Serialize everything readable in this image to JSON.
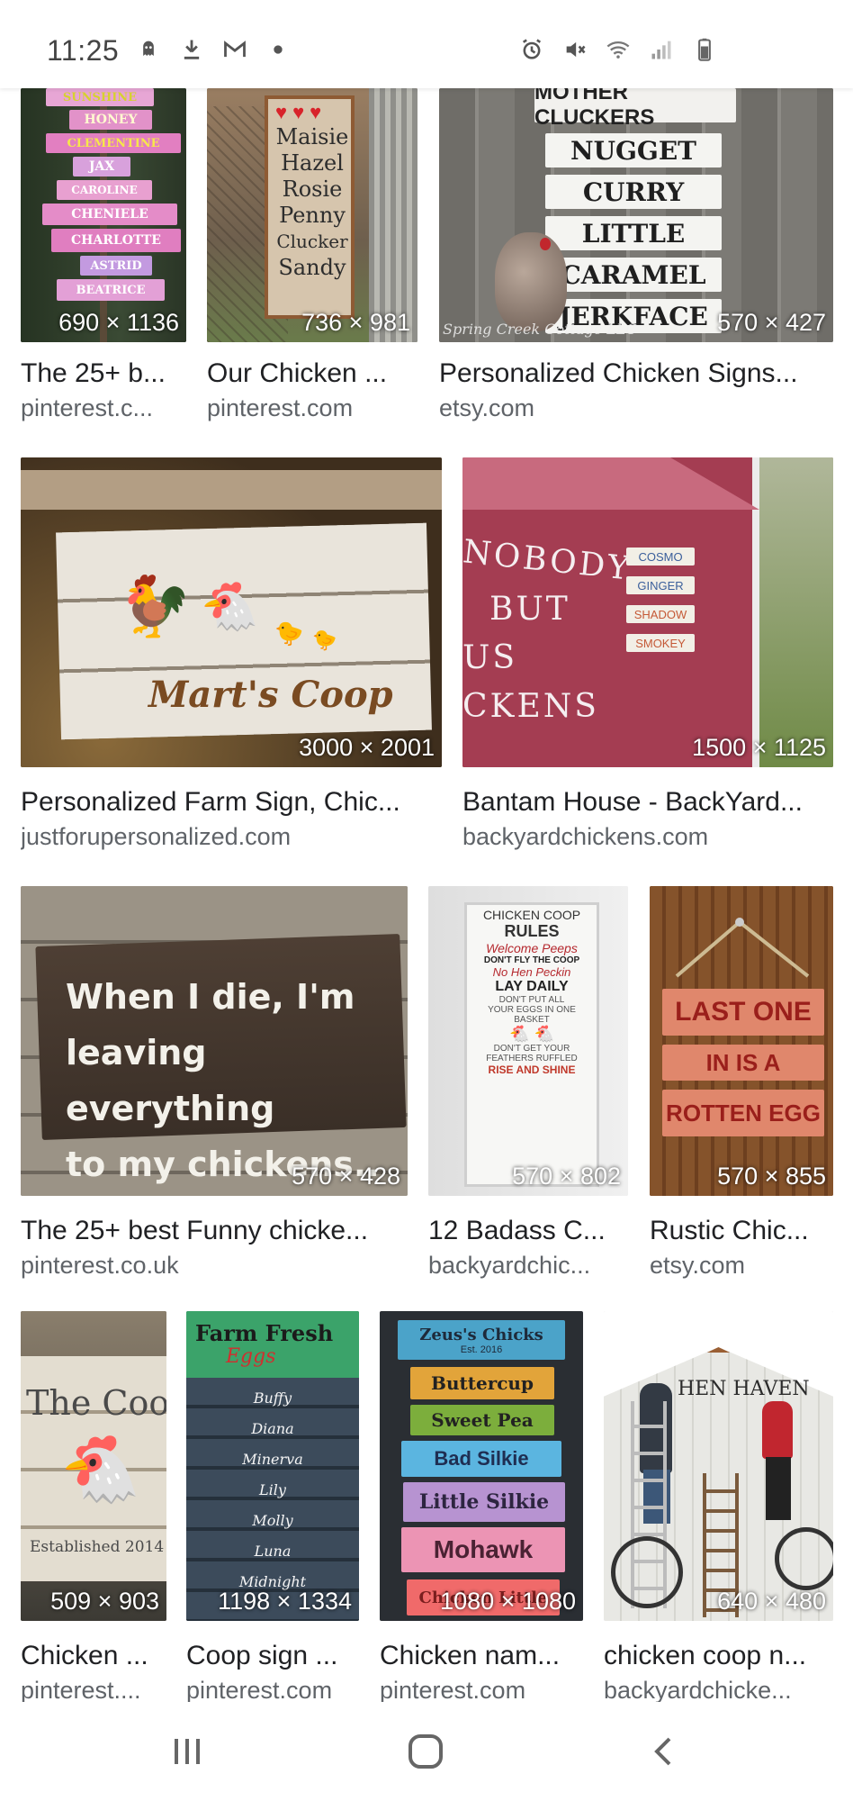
{
  "status_bar": {
    "time": "11:25",
    "left_icons": [
      "ghost-icon",
      "download-icon",
      "gmail-icon",
      "dot-icon"
    ],
    "right_icons": [
      "alarm-icon",
      "mute-icon",
      "wifi-icon",
      "signal-icon",
      "battery-icon"
    ]
  },
  "results": [
    {
      "title": "The 25+ b...",
      "domain": "pinterest.c...",
      "dims": "690 × 1136"
    },
    {
      "title": "Our Chicken ...",
      "domain": "pinterest.com",
      "dims": "736 × 981"
    },
    {
      "title": "Personalized Chicken Signs...",
      "domain": "etsy.com",
      "dims": "570 × 427"
    },
    {
      "title": "Personalized Farm Sign, Chic...",
      "domain": "justforupersonalized.com",
      "dims": "3000 × 2001"
    },
    {
      "title": "Bantam House - BackYard...",
      "domain": "backyardchickens.com",
      "dims": "1500 × 1125"
    },
    {
      "title": "The 25+ best Funny chicke...",
      "domain": "pinterest.co.uk",
      "dims": "570 × 428"
    },
    {
      "title": "12 Badass C...",
      "domain": "backyardchic...",
      "dims": "570 × 802"
    },
    {
      "title": "Rustic Chic...",
      "domain": "etsy.com",
      "dims": "570 × 855"
    },
    {
      "title": "Chicken ...",
      "domain": "pinterest....",
      "dims": "509 × 903"
    },
    {
      "title": "Coop sign ...",
      "domain": "pinterest.com",
      "dims": "1198 × 1334"
    },
    {
      "title": "Chicken nam...",
      "domain": "pinterest.com",
      "dims": "1080 × 1080"
    },
    {
      "title": "chicken coop n...",
      "domain": "backyardchicke...",
      "dims": "640 × 480"
    }
  ],
  "image_text": {
    "r1c1": [
      "SUNSHINE",
      "HONEY",
      "CLEMENTINE",
      "JAX",
      "CAROLINE",
      "CHENIELE",
      "CHARLOTTE",
      "ASTRID",
      "BEATRICE"
    ],
    "r1c2": [
      "Maisie",
      "Hazel",
      "Rosie",
      "Penny",
      "Clucker",
      "Sandy"
    ],
    "r1c3": [
      "MOTHER CLUCKERS",
      "NUGGET",
      "CURRY",
      "LITTLE",
      "CARAMEL",
      "JERKFACE",
      "Spring Creek Cottage LLC"
    ],
    "r2c1": "Mart's Coop",
    "r2c2_wall": [
      "NOBODY",
      "BUT",
      "US",
      "CKENS"
    ],
    "r2c2_tags": [
      "COSMO",
      "GINGER",
      "SHADOW",
      "SMOKEY"
    ],
    "r3c1": [
      "When I die, I'm",
      "leaving everything",
      "to my chickens.."
    ],
    "r3c2": [
      "CHICKEN COOP",
      "RULES",
      "Welcome Peeps",
      "DON'T FLY THE COOP",
      "No Hen Peckin",
      "LAY DAILY",
      "DON'T PUT ALL",
      "YOUR EGGS IN ONE",
      "BASKET",
      "DON'T GET YOUR",
      "FEATHERS RUFFLED",
      "RISE AND SHINE"
    ],
    "r3c3": [
      "LAST ONE",
      "IN IS A",
      "ROTTEN EGG"
    ],
    "r4c1": [
      "The Coop",
      "Established 2014"
    ],
    "r4c2": [
      "Farm Fresh",
      "Eggs",
      "Buffy",
      "Diana",
      "Minerva",
      "Lily",
      "Molly",
      "Luna",
      "Midnight"
    ],
    "r4c3": [
      "Zeus's Chicks",
      "Est. 2016",
      "Buttercup",
      "Sweet Pea",
      "Bad Silkie",
      "Little Silkie",
      "Mohawk",
      "Chicken Little"
    ],
    "r4c4": "HEN HAVEN"
  },
  "nav": {
    "recent": "recent-apps-icon",
    "home": "home-icon",
    "back": "back-icon"
  }
}
